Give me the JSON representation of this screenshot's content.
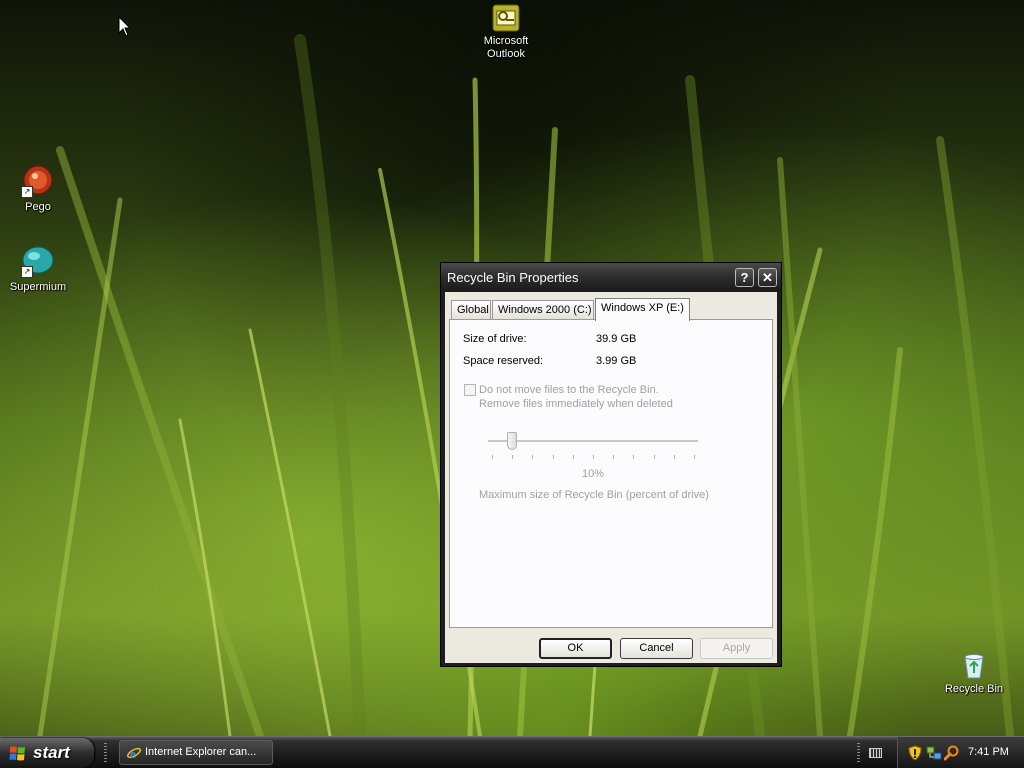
{
  "desktop": {
    "icons": [
      {
        "label": "Microsoft\nOutlook",
        "line1": "Microsoft",
        "line2": "Outlook",
        "icon": "outlook-icon"
      },
      {
        "label": "Pego",
        "icon": "pego-icon"
      },
      {
        "label": "Supermium",
        "icon": "supermium-icon"
      },
      {
        "label": "Recycle Bin",
        "icon": "recycle-bin-icon"
      }
    ]
  },
  "dialog": {
    "title": "Recycle Bin Properties",
    "help_glyph": "?",
    "close_glyph": "✕",
    "tabs": [
      {
        "label": "Global",
        "active": false
      },
      {
        "label": "Windows 2000 (C:)",
        "active": false
      },
      {
        "label": "Windows XP (E:)",
        "active": true
      }
    ],
    "size_of_drive_label": "Size of drive:",
    "size_of_drive_value": "39.9 GB",
    "space_reserved_label": "Space reserved:",
    "space_reserved_value": "3.99 GB",
    "checkbox_line1": "Do not move files to the Recycle Bin.",
    "checkbox_line2": "Remove files immediately when deleted",
    "checkbox_checked": false,
    "slider_percent": 10,
    "slider_label": "10%",
    "slider_caption": "Maximum size of Recycle Bin (percent of drive)",
    "buttons": {
      "ok": "OK",
      "cancel": "Cancel",
      "apply": "Apply"
    }
  },
  "taskbar": {
    "start_label": "start",
    "tasks": [
      {
        "label": "Internet Explorer can...",
        "icon": "ie-icon"
      }
    ],
    "tray_icons": [
      "shield-icon",
      "network-icon",
      "search-icon"
    ],
    "clock": "7:41 PM"
  },
  "colors": {
    "dialog_chrome": "#1e1e1e",
    "dialog_face": "#ece9e0",
    "taskbar": "#1d1d1d",
    "disabled_text": "#a0a0a0"
  }
}
